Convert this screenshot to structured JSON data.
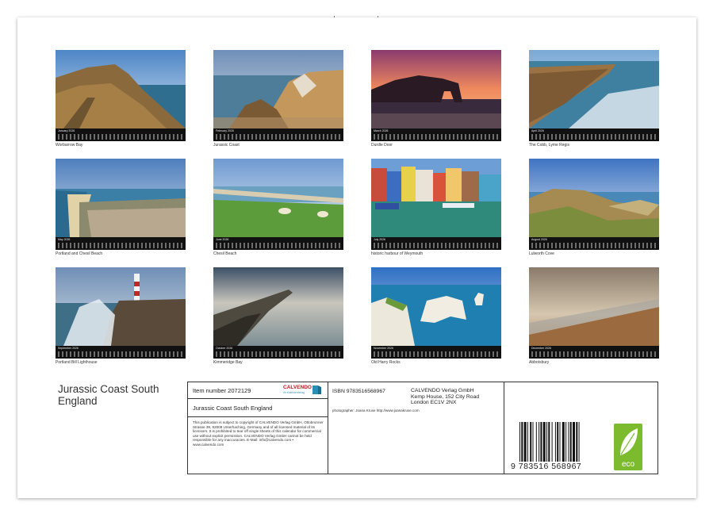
{
  "calendar": {
    "title": "Jurassic Coast South England",
    "tiles": [
      {
        "month": "January 2026",
        "caption": "Worbarrow Bay"
      },
      {
        "month": "February 2026",
        "caption": "Jurassic Coast"
      },
      {
        "month": "March 2026",
        "caption": "Durdle Door"
      },
      {
        "month": "April 2026",
        "caption": "The Cobb, Lyme Regis"
      },
      {
        "month": "May 2026",
        "caption": "Portland and Chesil Beach"
      },
      {
        "month": "June 2026",
        "caption": "Chesil Beach"
      },
      {
        "month": "July 2026",
        "caption": "historic harbour of Weymouth"
      },
      {
        "month": "August 2026",
        "caption": "Lulworth Cove"
      },
      {
        "month": "September 2026",
        "caption": "Portland Bill Lighthouse"
      },
      {
        "month": "October 2026",
        "caption": "Kimmeridge Bay"
      },
      {
        "month": "November 2026",
        "caption": "Old Harry Rocks"
      },
      {
        "month": "December 2026",
        "caption": "Abbotsbury"
      }
    ]
  },
  "info": {
    "item_label": "Item number 2072129",
    "logo": "CALVENDO",
    "logo_sub": "Ihr Kalenderverlag",
    "subtitle": "Jurassic Coast South England",
    "copyright": "This publication is subject to copyright of CALVENDO Verlag GmbH, Ottobrunner Strasse 39, 82008 Unterhaching, Germany and of all licensed material of its licensors. It is prohibited to tear off single sheets of this calendar for commercial use without explicit permission. CALVENDO Verlag GmbH cannot be held responsible for any inaccuracies. E-Mail: info@calvendo.com • www.calvendo.com",
    "isbn": "ISBN 9783516568967",
    "publisher_line1": "CALVENDO Verlag GmbH",
    "publisher_line2": "Kemp House, 152 City Road",
    "publisher_line3": "London EC1V 2NX",
    "photographer": "photographer: Joana Kruse http://www.joanakruse.com",
    "barcode_number": "9  783516  568967",
    "eco_label": "eco"
  }
}
